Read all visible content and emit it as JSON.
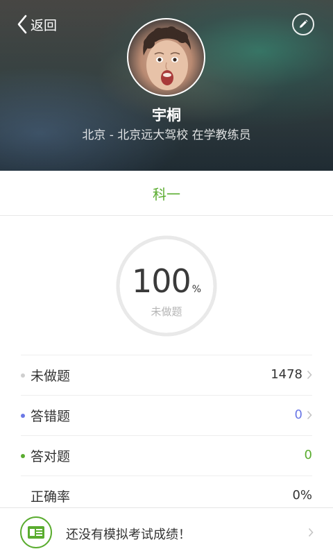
{
  "header": {
    "back_label": "返回",
    "user_name": "宇桐",
    "user_subtitle": "北京 - 北京远大驾校 在学教练员"
  },
  "subject_tab": {
    "label": "科一",
    "color": "#5aac2f"
  },
  "progress": {
    "value": "100",
    "unit": "%",
    "label": "未做题",
    "fraction": 1.0
  },
  "stats": [
    {
      "name": "未做题",
      "value": "1478",
      "dot_color": "#cfcfcf",
      "value_color": "#333333",
      "has_chevron": true
    },
    {
      "name": "答错题",
      "value": "0",
      "dot_color": "#6b78e6",
      "value_color": "#6b78e6",
      "has_chevron": true
    },
    {
      "name": "答对题",
      "value": "0",
      "dot_color": "#5aac2f",
      "value_color": "#5aac2f",
      "has_chevron": false
    },
    {
      "name": "正确率",
      "value": "0%",
      "dot_color": "",
      "value_color": "#333333",
      "has_chevron": false
    }
  ],
  "bottom_bar": {
    "text": "还没有模拟考试成绩！",
    "icon": "certificate-icon"
  },
  "icons": {
    "back": "chevron-left-icon",
    "edit": "pencil-icon",
    "row_chevron": "chevron-right-icon"
  }
}
